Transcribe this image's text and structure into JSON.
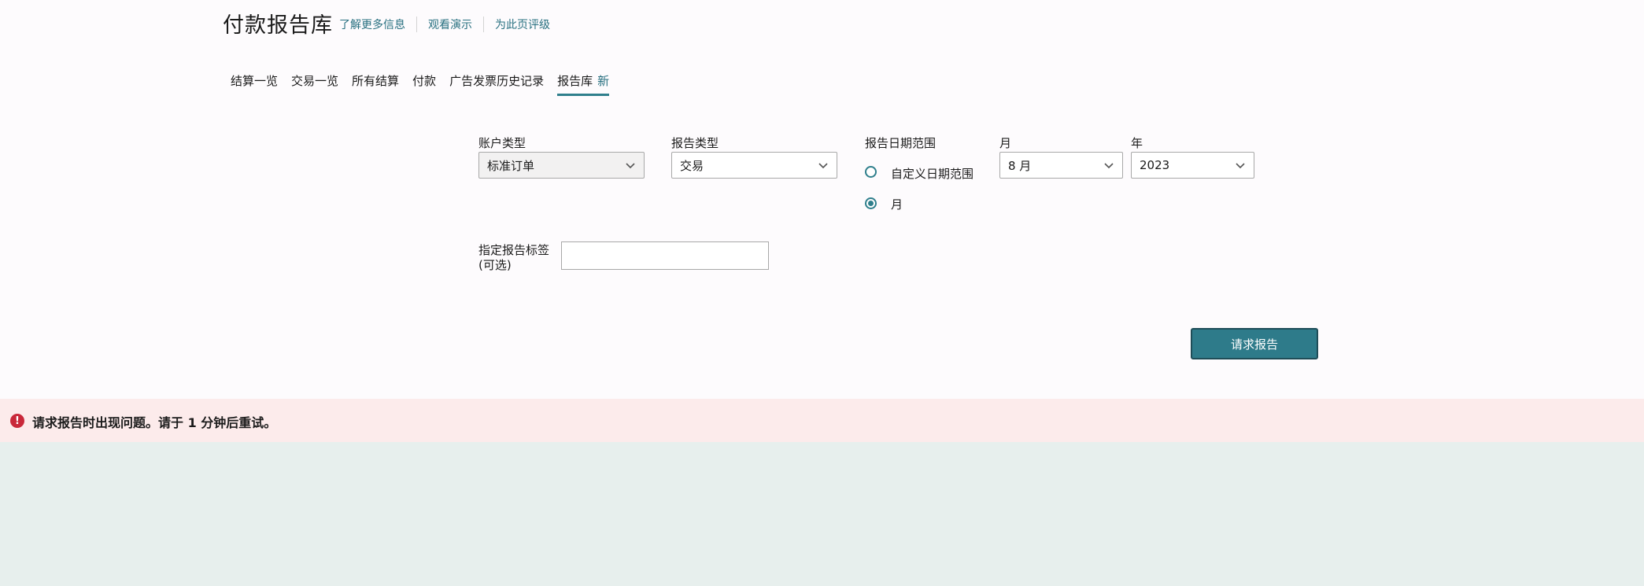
{
  "header": {
    "title": "付款报告库",
    "links": [
      "了解更多信息",
      "观看演示",
      "为此页评级"
    ]
  },
  "tabs": [
    {
      "label": "结算一览"
    },
    {
      "label": "交易一览"
    },
    {
      "label": "所有结算"
    },
    {
      "label": "付款"
    },
    {
      "label": "广告发票历史记录"
    },
    {
      "label": "报告库",
      "badge": "新",
      "active": true
    }
  ],
  "form": {
    "account_type": {
      "label": "账户类型",
      "value": "标准订单"
    },
    "report_type": {
      "label": "报告类型",
      "value": "交易"
    },
    "date_range": {
      "label": "报告日期范围",
      "options": [
        {
          "label": "自定义日期范围",
          "checked": false
        },
        {
          "label": "月",
          "checked": true
        }
      ]
    },
    "month": {
      "label": "月",
      "value": "8 月"
    },
    "year": {
      "label": "年",
      "value": "2023"
    },
    "report_tag": {
      "label_line1": "指定报告标签",
      "label_line2": "(可选)",
      "value": ""
    },
    "submit_label": "请求报告"
  },
  "error": {
    "icon": "exclamation-icon",
    "message": "请求报告时出现问题。请于 1 分钟后重试。"
  },
  "colors": {
    "accent": "#2f7f8c",
    "link": "#287080",
    "error": "#c9283a",
    "error_bg": "#fcebeb",
    "button": "#2e7b8a"
  }
}
